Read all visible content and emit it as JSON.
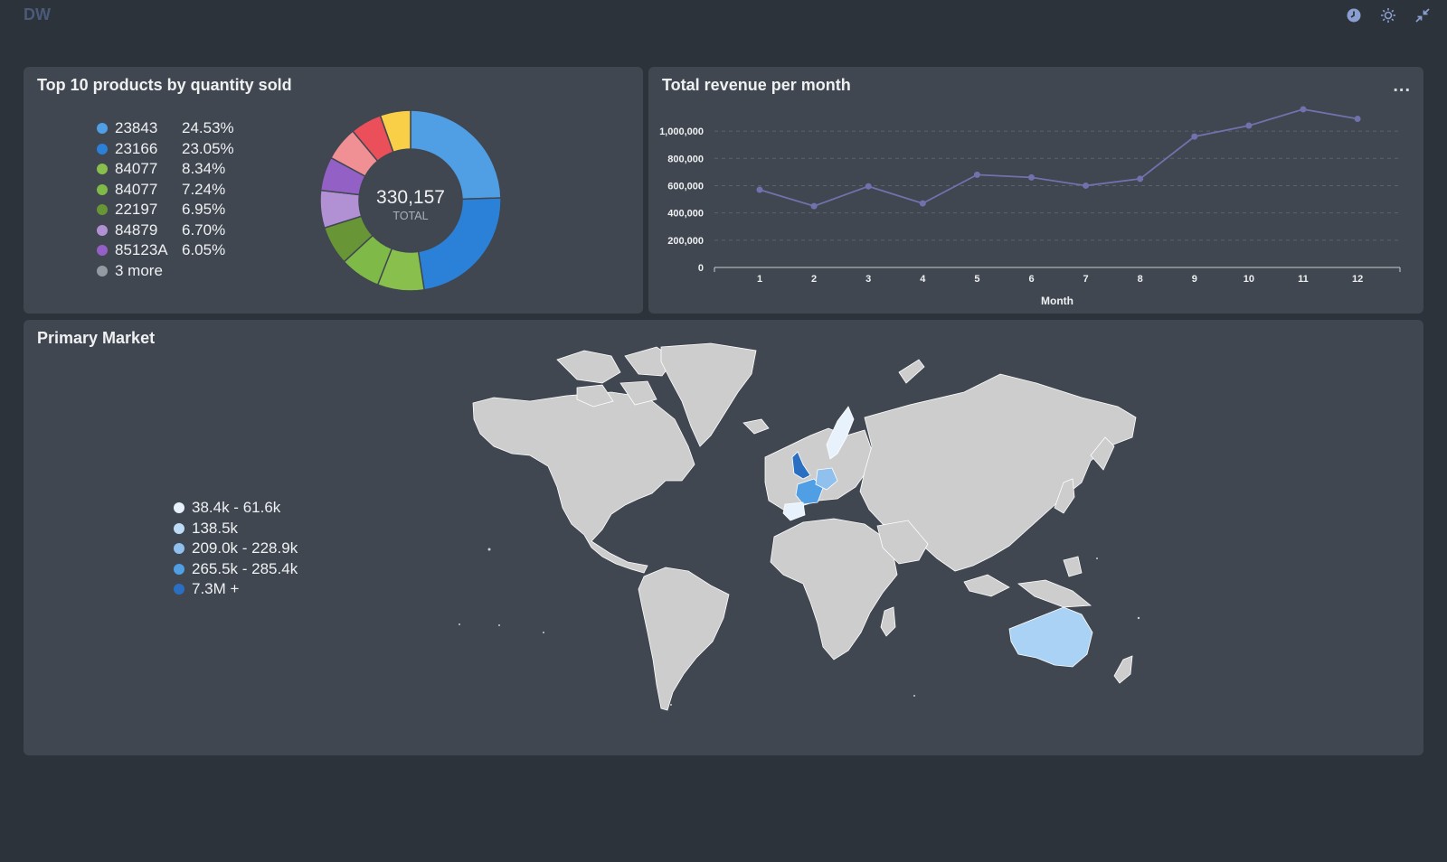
{
  "app": {
    "title": "DW"
  },
  "toolbar": {
    "icons": [
      "clock-icon",
      "sun-icon",
      "collapse-icon"
    ]
  },
  "donut_card": {
    "title": "Top 10 products by quantity sold",
    "total_value": "330,157",
    "total_label": "TOTAL",
    "legend": [
      {
        "label": "23843",
        "pct": "24.53%",
        "color": "#509ee3"
      },
      {
        "label": "23166",
        "pct": "23.05%",
        "color": "#2b80d8"
      },
      {
        "label": "84077",
        "pct": "8.34%",
        "color": "#88bf4d"
      },
      {
        "label": "84077",
        "pct": "7.24%",
        "color": "#7fba48"
      },
      {
        "label": "22197",
        "pct": "6.95%",
        "color": "#689636"
      },
      {
        "label": "84879",
        "pct": "6.70%",
        "color": "#b191d4"
      },
      {
        "label": "85123A",
        "pct": "6.05%",
        "color": "#9360c6"
      },
      {
        "label": "3 more",
        "pct": "",
        "color": "#949aa1"
      }
    ],
    "slices": [
      {
        "pct": 24.53,
        "color": "#509ee3"
      },
      {
        "pct": 23.05,
        "color": "#2b80d8"
      },
      {
        "pct": 8.34,
        "color": "#88bf4d"
      },
      {
        "pct": 7.24,
        "color": "#7fba48"
      },
      {
        "pct": 6.95,
        "color": "#689636"
      },
      {
        "pct": 6.7,
        "color": "#b191d4"
      },
      {
        "pct": 6.05,
        "color": "#9360c6"
      },
      {
        "pct": 6.1,
        "color": "#f08f94"
      },
      {
        "pct": 5.6,
        "color": "#ea4f5a"
      },
      {
        "pct": 5.44,
        "color": "#f9cf48"
      }
    ]
  },
  "revenue_card": {
    "title": "Total revenue per month",
    "menu_label": "..."
  },
  "chart_data": {
    "type": "line",
    "title": "Total revenue per month",
    "xlabel": "Month",
    "ylabel": "",
    "x": [
      1,
      2,
      3,
      4,
      5,
      6,
      7,
      8,
      9,
      10,
      11,
      12
    ],
    "series": [
      {
        "values": [
          570000,
          450000,
          595000,
          470000,
          680000,
          660000,
          600000,
          650000,
          960000,
          1040000,
          1160000,
          1090000
        ]
      }
    ],
    "ylim": [
      0,
      1100000
    ],
    "yticks": [
      "0",
      "200,000",
      "400,000",
      "600,000",
      "800,000",
      "1,000,000"
    ],
    "xticks": [
      "1",
      "2",
      "3",
      "4",
      "5",
      "6",
      "7",
      "8",
      "9",
      "10",
      "11",
      "12"
    ],
    "grid": true,
    "color": "#7172ad"
  },
  "map_card": {
    "title": "Primary Market",
    "legend": [
      {
        "label": "38.4k - 61.6k",
        "color": "#e7f2fd"
      },
      {
        "label": "138.5k",
        "color": "#bfdcf6"
      },
      {
        "label": "209.0k - 228.9k",
        "color": "#8fc0ee"
      },
      {
        "label": "265.5k - 285.4k",
        "color": "#509ee3"
      },
      {
        "label": "7.3M +",
        "color": "#2a6fc2"
      }
    ],
    "land_color": "#cdcdcd",
    "highlight_colors": {
      "uk": "#2a6fc2",
      "france": "#509ee3",
      "germany": "#8fc0ee",
      "australia": "#a9d2f5",
      "scandinavia": "#e7f2fd",
      "spain": "#e7f2fd"
    }
  }
}
